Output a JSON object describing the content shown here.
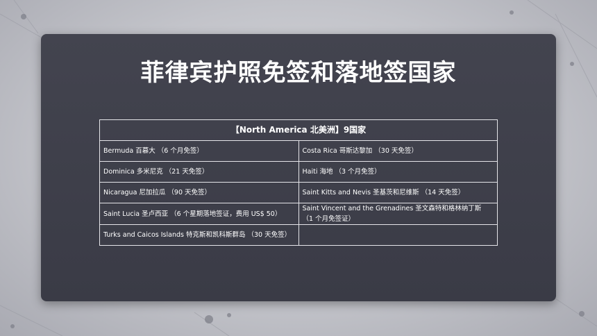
{
  "title": "菲律宾护照免签和落地签国家",
  "table": {
    "header": "【North America 北美洲】9国家",
    "rows": [
      [
        "Bermuda 百慕大 （6 个月免签）",
        "Costa Rica 哥斯达黎加 （30 天免签）"
      ],
      [
        "Dominica 多米尼克 （21 天免签）",
        "Haiti 海地 （3 个月免签）"
      ],
      [
        "Nicaragua 尼加拉瓜 （90 天免签）",
        "Saint Kitts and Nevis 圣基茨和尼维斯 （14 天免签）"
      ],
      [
        "Saint Lucia 圣卢西亚 （6 个星期落地签证，费用 US$ 50）",
        "Saint Vincent and the Grenadines 圣文森特和格林纳丁斯 （1 个月免签证）"
      ],
      [
        "Turks and Caicos Islands 特克斯和凯科斯群岛 （30 天免签）",
        ""
      ]
    ]
  }
}
